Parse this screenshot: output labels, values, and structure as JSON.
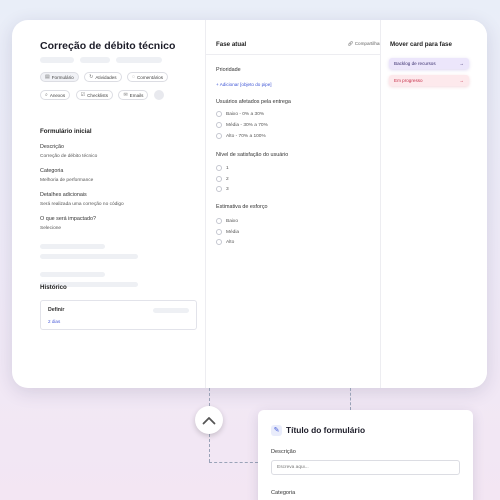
{
  "card": {
    "title": "Correção de débito técnico",
    "tabs": [
      {
        "icon": "form-icon",
        "glyph": "▤",
        "label": "Formulário"
      },
      {
        "icon": "activities-icon",
        "glyph": "↻",
        "label": "Atividades"
      },
      {
        "icon": "comments-icon",
        "glyph": "◌",
        "label": "Comentários"
      },
      {
        "icon": "attachments-icon",
        "glyph": "⌕",
        "label": "Anexos"
      },
      {
        "icon": "checklists-icon",
        "glyph": "☑",
        "label": "Checklists"
      },
      {
        "icon": "email-icon",
        "glyph": "✉",
        "label": "Emails"
      }
    ]
  },
  "form": {
    "heading": "Formulário inicial",
    "fields": [
      {
        "label": "Descrição",
        "value": "Correção de débito técnico"
      },
      {
        "label": "Categoria",
        "value": "Melhoria de performance"
      },
      {
        "label": "Detalhes adicionais",
        "value": "Será realizada uma correção no código"
      },
      {
        "label": "O que será impactado?",
        "value": "Selecione"
      }
    ]
  },
  "history": {
    "heading": "Histórico",
    "entry_name": "Definir",
    "entry_when": "2 dias"
  },
  "phase": {
    "heading": "Fase atual",
    "share_label": "Compartilhar",
    "priority_label": "Prioridade",
    "add_link": "+ Adicionar [objeto do pipe]",
    "users_label": "Usuários afetados pela entrega",
    "users_options": [
      "Baixo - 0% a 30%",
      "Média - 30% a 70%",
      "Alto - 70% a 100%"
    ],
    "satisfaction_label": "Nível de satisfação do usuário",
    "satisfaction_options": [
      "1",
      "2",
      "3"
    ],
    "effort_label": "Estimativa de esforço",
    "effort_options": [
      "Baixo",
      "Média",
      "Alto"
    ]
  },
  "move": {
    "heading": "Mover card para fase",
    "buttons": [
      {
        "label": "Backlog de recursos",
        "arrow": "→"
      },
      {
        "label": "Em progresso",
        "arrow": "→"
      }
    ]
  },
  "form_card": {
    "title": "Título do formulário",
    "description_label": "Descrição",
    "description_placeholder": "Escreva aqui...",
    "category_label": "Categoria"
  },
  "colors": {
    "accent": "#3f56d6",
    "phase_purple": "#ece6fb",
    "phase_red": "#c63049"
  }
}
